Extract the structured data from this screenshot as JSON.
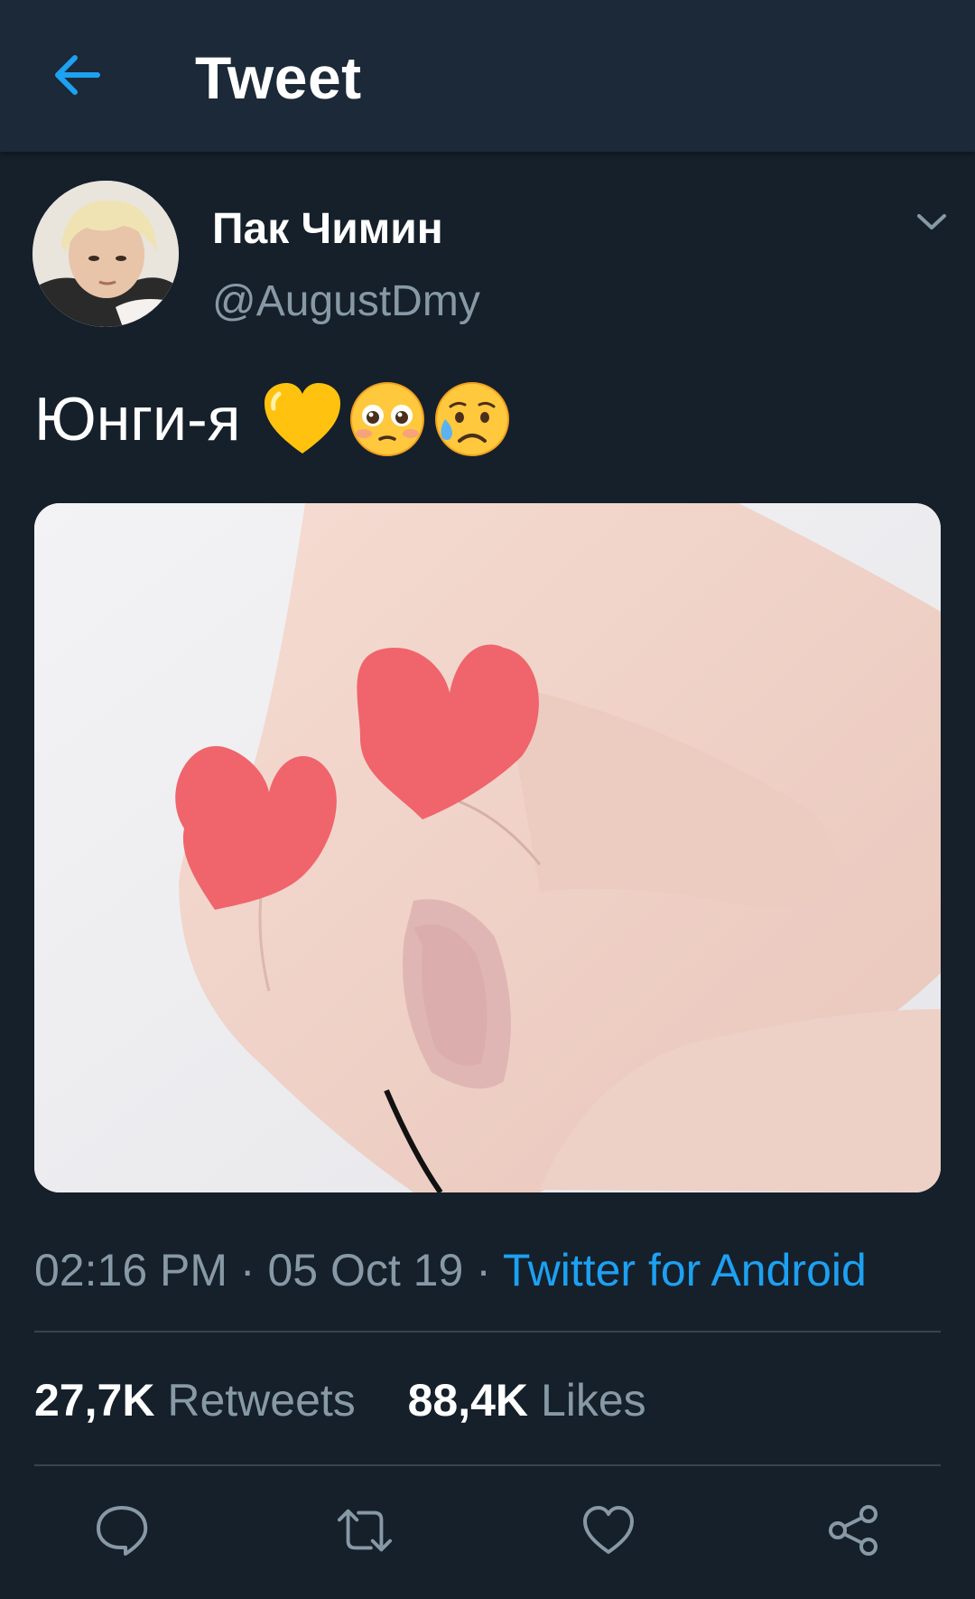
{
  "header": {
    "title": "Tweet",
    "back_icon": "arrow-left-icon"
  },
  "tweet": {
    "display_name": "Пак Чимин",
    "handle": "@AugustDmy",
    "text": "Юнги-я",
    "emojis": [
      "yellow-heart",
      "flushed-face",
      "sad-but-relieved-face"
    ],
    "time": "02:16 PM",
    "date": "05 Oct 19",
    "separator": "·",
    "source": "Twitter for Android"
  },
  "stats": {
    "retweets_count": "27,7K",
    "retweets_label": "Retweets",
    "likes_count": "88,4K",
    "likes_label": "Likes"
  },
  "colors": {
    "background": "#15202b",
    "header_background": "#1c2938",
    "accent": "#1da1f2",
    "secondary_text": "#8899a6",
    "divider": "#38444d"
  },
  "actions": [
    "reply-icon",
    "retweet-icon",
    "like-icon",
    "share-icon"
  ]
}
